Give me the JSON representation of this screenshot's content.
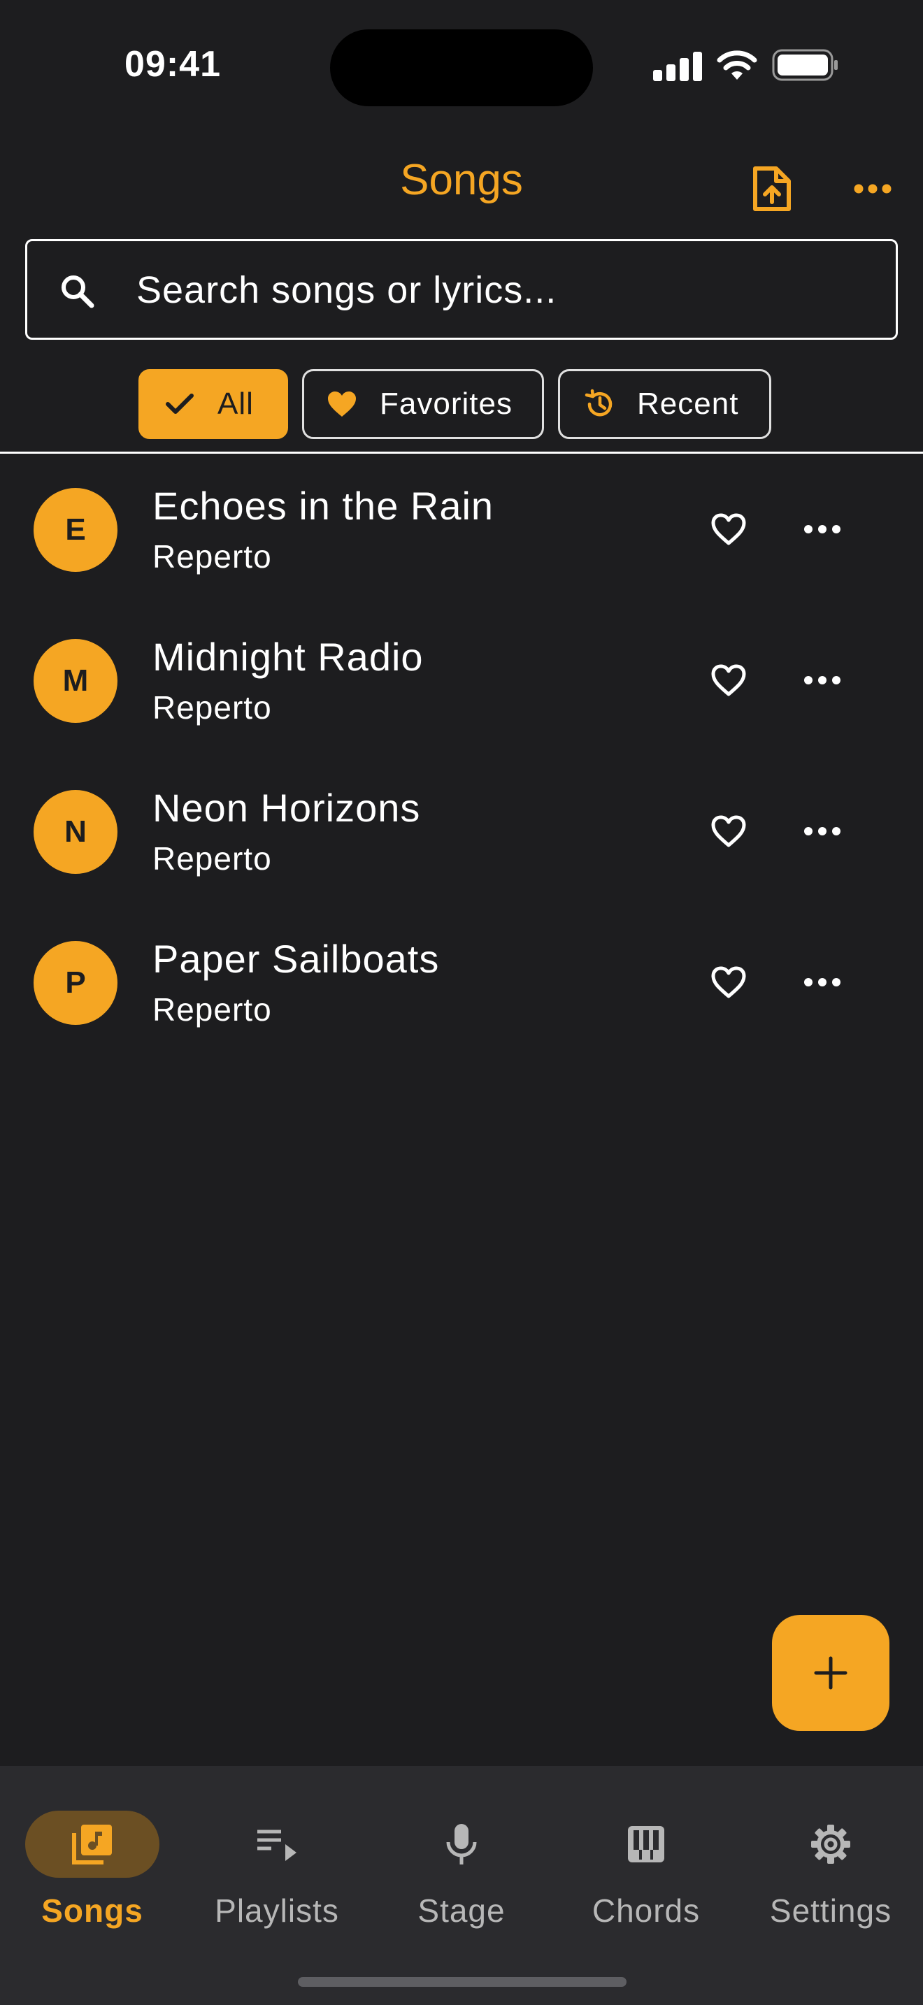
{
  "status_bar": {
    "time": "09:41"
  },
  "header": {
    "title": "Songs",
    "import_icon": "file-upload-icon",
    "more_icon": "more-horizontal-icon"
  },
  "search": {
    "placeholder": "Search songs or lyrics...",
    "value": ""
  },
  "filters": [
    {
      "label": "All",
      "icon": "check-icon",
      "selected": true
    },
    {
      "label": "Favorites",
      "icon": "heart-filled-icon",
      "selected": false
    },
    {
      "label": "Recent",
      "icon": "history-icon",
      "selected": false
    }
  ],
  "songs": [
    {
      "initial": "E",
      "title": "Echoes in the Rain",
      "artist": "Reperto"
    },
    {
      "initial": "M",
      "title": "Midnight Radio",
      "artist": "Reperto"
    },
    {
      "initial": "N",
      "title": "Neon Horizons",
      "artist": "Reperto"
    },
    {
      "initial": "P",
      "title": "Paper Sailboats",
      "artist": "Reperto"
    }
  ],
  "fab": {
    "icon": "plus-icon"
  },
  "nav": [
    {
      "label": "Songs",
      "icon": "music-library-icon",
      "active": true
    },
    {
      "label": "Playlists",
      "icon": "playlist-play-icon",
      "active": false
    },
    {
      "label": "Stage",
      "icon": "microphone-icon",
      "active": false
    },
    {
      "label": "Chords",
      "icon": "piano-icon",
      "active": false
    },
    {
      "label": "Settings",
      "icon": "gear-icon",
      "active": false
    }
  ],
  "colors": {
    "accent": "#f5a623",
    "background": "#1d1d1f",
    "nav_background": "#2b2b2e",
    "active_pill": "#6b4f23"
  }
}
